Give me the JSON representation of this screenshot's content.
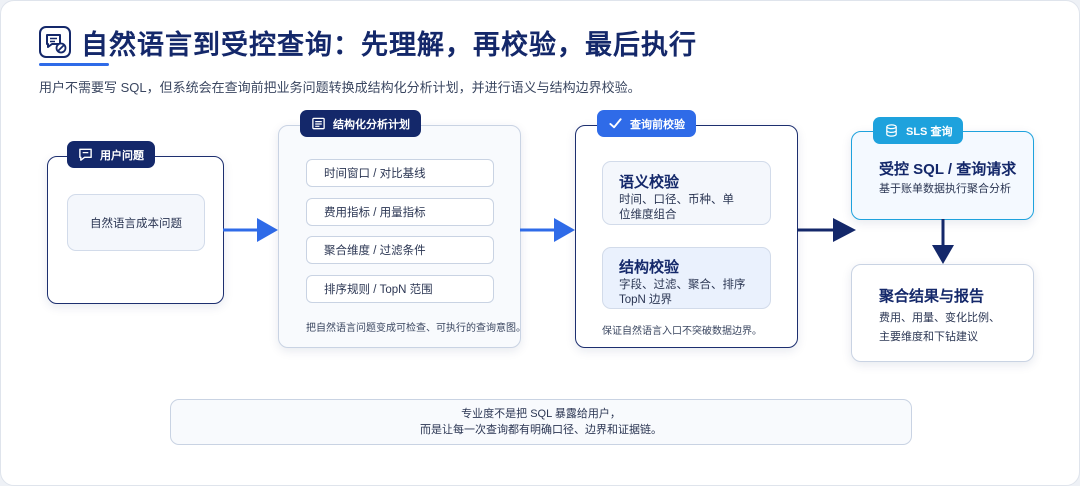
{
  "header": {
    "title": "自然语言到受控查询：先理解，再校验，最后执行",
    "subtitle": "用户不需要写 SQL，但系统会在查询前把业务问题转换成结构化分析计划，并进行语义与结构边界校验。"
  },
  "user_question": {
    "tag": "用户问题",
    "question": "自然语言成本问题"
  },
  "analysis_plan": {
    "tag": "结构化分析计划",
    "items": [
      "时间窗口 / 对比基线",
      "费用指标 / 用量指标",
      "聚合维度 / 过滤条件",
      "排序规则 / TopN 范围"
    ],
    "note": "把自然语言问题变成可检查、可执行的查询意图。"
  },
  "pre_query_check": {
    "tag": "查询前校验",
    "semantic": {
      "title": "语义校验",
      "text": "时间、口径、币种、单位维度组合"
    },
    "structural": {
      "title": "结构校验",
      "text": "字段、过滤、聚合、排序 TopN 边界"
    },
    "note": "保证自然语言入口不突破数据边界。"
  },
  "sls_query": {
    "tag": "SLS 查询",
    "title": "受控 SQL / 查询请求",
    "text": "基于账单数据执行聚合分析"
  },
  "result": {
    "title": "聚合结果与报告",
    "line1": "费用、用量、变化比例、",
    "line2": "主要维度和下钻建议"
  },
  "footer": {
    "line1": "专业度不是把 SQL 暴露给用户，",
    "line2": "而是让每一次查询都有明确口径、边界和证据链。"
  },
  "colors": {
    "navy": "#14286a",
    "accent_blue": "#2f6be8",
    "sky": "#1ea2dd"
  },
  "icons": [
    "chat-bubble-icon",
    "document-list-icon",
    "checkmark-icon",
    "database-icon",
    "chat-slash-icon"
  ]
}
